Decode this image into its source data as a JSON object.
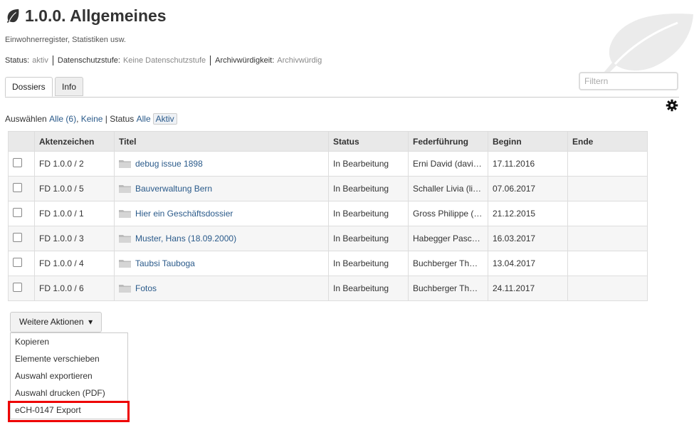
{
  "header": {
    "title": "1.0.0. Allgemeines",
    "subtitle": "Einwohnerregister, Statistiken usw.",
    "status_label": "Status:",
    "status_value": "aktiv",
    "privacy_label": "Datenschutzstufe:",
    "privacy_value": "Keine Datenschutzstufe",
    "archive_label": "Archivwürdigkeit:",
    "archive_value": "Archivwürdig"
  },
  "filter": {
    "placeholder": "Filtern"
  },
  "tabs": [
    {
      "label": "Dossiers",
      "active": true
    },
    {
      "label": "Info",
      "active": false
    }
  ],
  "selection": {
    "label": "Auswählen",
    "all": "Alle (6)",
    "none": "Keine",
    "status_label": "Status",
    "status_all": "Alle",
    "status_active": "Aktiv"
  },
  "table": {
    "columns": [
      "",
      "Aktenzeichen",
      "Titel",
      "Status",
      "Federführung",
      "Beginn",
      "Ende"
    ],
    "rows": [
      {
        "ref": "FD 1.0.0 / 2",
        "title": "debug issue 1898",
        "status": "In Bearbeitung",
        "lead": "Erni David (davi…",
        "start": "17.11.2016",
        "end": ""
      },
      {
        "ref": "FD 1.0.0 / 5",
        "title": "Bauverwaltung Bern",
        "status": "In Bearbeitung",
        "lead": "Schaller Livia (li…",
        "start": "07.06.2017",
        "end": ""
      },
      {
        "ref": "FD 1.0.0 / 1",
        "title": "Hier ein Geschäftsdossier",
        "status": "In Bearbeitung",
        "lead": "Gross Philippe (…",
        "start": "21.12.2015",
        "end": ""
      },
      {
        "ref": "FD 1.0.0 / 3",
        "title": "Muster, Hans (18.09.2000)",
        "status": "In Bearbeitung",
        "lead": "Habegger Pasc…",
        "start": "16.03.2017",
        "end": ""
      },
      {
        "ref": "FD 1.0.0 / 4",
        "title": "Taubsi Tauboga",
        "status": "In Bearbeitung",
        "lead": "Buchberger Th…",
        "start": "13.04.2017",
        "end": ""
      },
      {
        "ref": "FD 1.0.0 / 6",
        "title": "Fotos",
        "status": "In Bearbeitung",
        "lead": "Buchberger Th…",
        "start": "24.11.2017",
        "end": ""
      }
    ]
  },
  "actions": {
    "button_label": "Weitere Aktionen",
    "items": [
      "Kopieren",
      "Elemente verschieben",
      "Auswahl exportieren",
      "Auswahl drucken (PDF)",
      "eCH-0147 Export"
    ],
    "highlighted_item": "eCH-0147 Export"
  },
  "icons": {
    "title": "leaf-icon",
    "background": "leaf-watermark",
    "settings": "gear-icon",
    "folder": "folder-icon",
    "dropdown": "caret-down-icon"
  },
  "colors": {
    "link": "#2a5a8a",
    "highlight": "#e00000",
    "header_bg": "#e9e9e9"
  }
}
